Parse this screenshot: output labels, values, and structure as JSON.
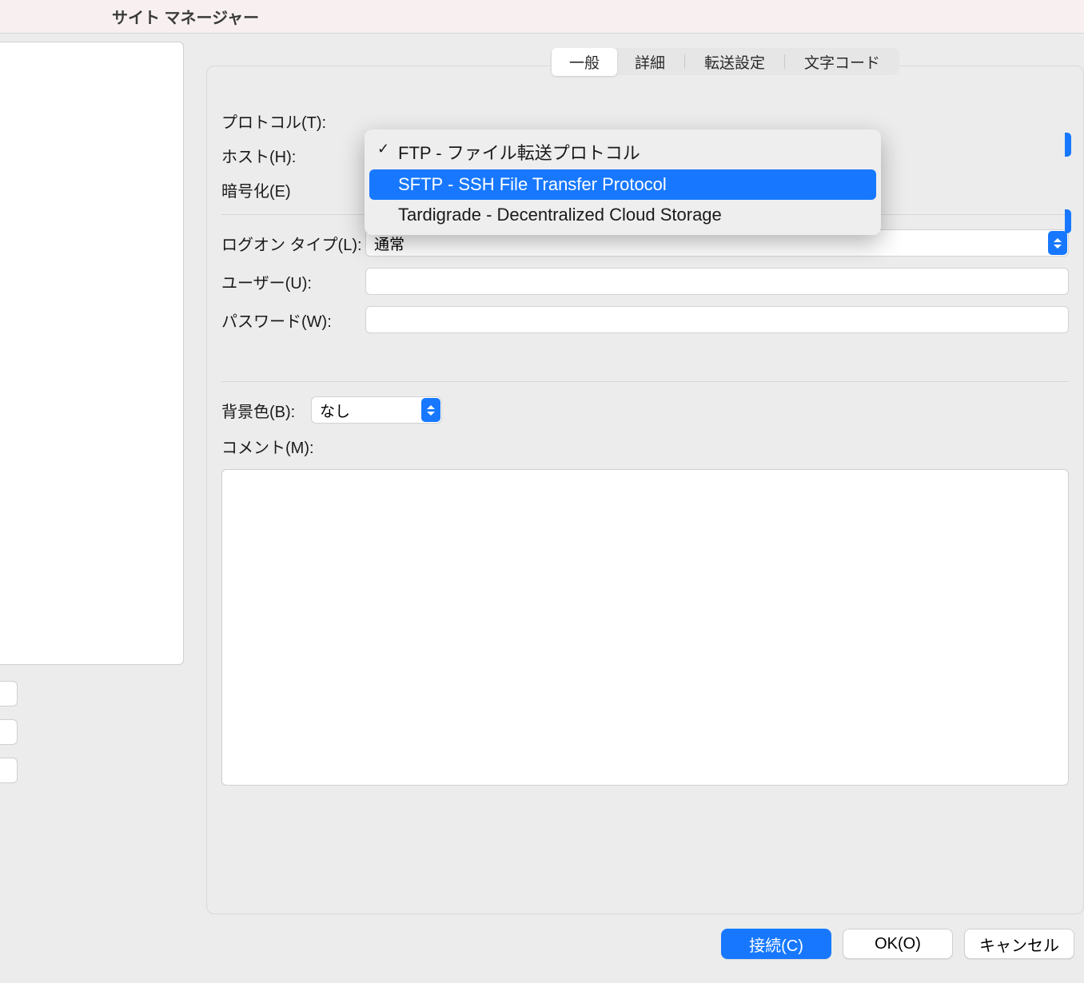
{
  "window": {
    "title": "サイト マネージャー"
  },
  "tabs": {
    "general": "一般",
    "advanced": "詳細",
    "transfer": "転送設定",
    "charset": "文字コード"
  },
  "labels": {
    "protocol": "プロトコル(T):",
    "host": "ホスト(H):",
    "encryption": "暗号化(E)",
    "logon_type": "ログオン タイプ(L):",
    "user": "ユーザー(U):",
    "password": "パスワード(W):",
    "bgcolor": "背景色(B):",
    "comments": "コメント(M):"
  },
  "fields": {
    "host": "",
    "user": "",
    "password": "",
    "logon_type": "通常",
    "bgcolor": "なし",
    "comments": ""
  },
  "protocol_dropdown": {
    "options": [
      {
        "label": "FTP - ファイル転送プロトコル",
        "checked": true
      },
      {
        "label": "SFTP - SSH File Transfer Protocol",
        "highlighted": true
      },
      {
        "label": "Tardigrade - Decentralized Cloud Storage"
      }
    ]
  },
  "buttons": {
    "connect": "接続(C)",
    "ok": "OK(O)",
    "cancel": "キャンセル"
  }
}
